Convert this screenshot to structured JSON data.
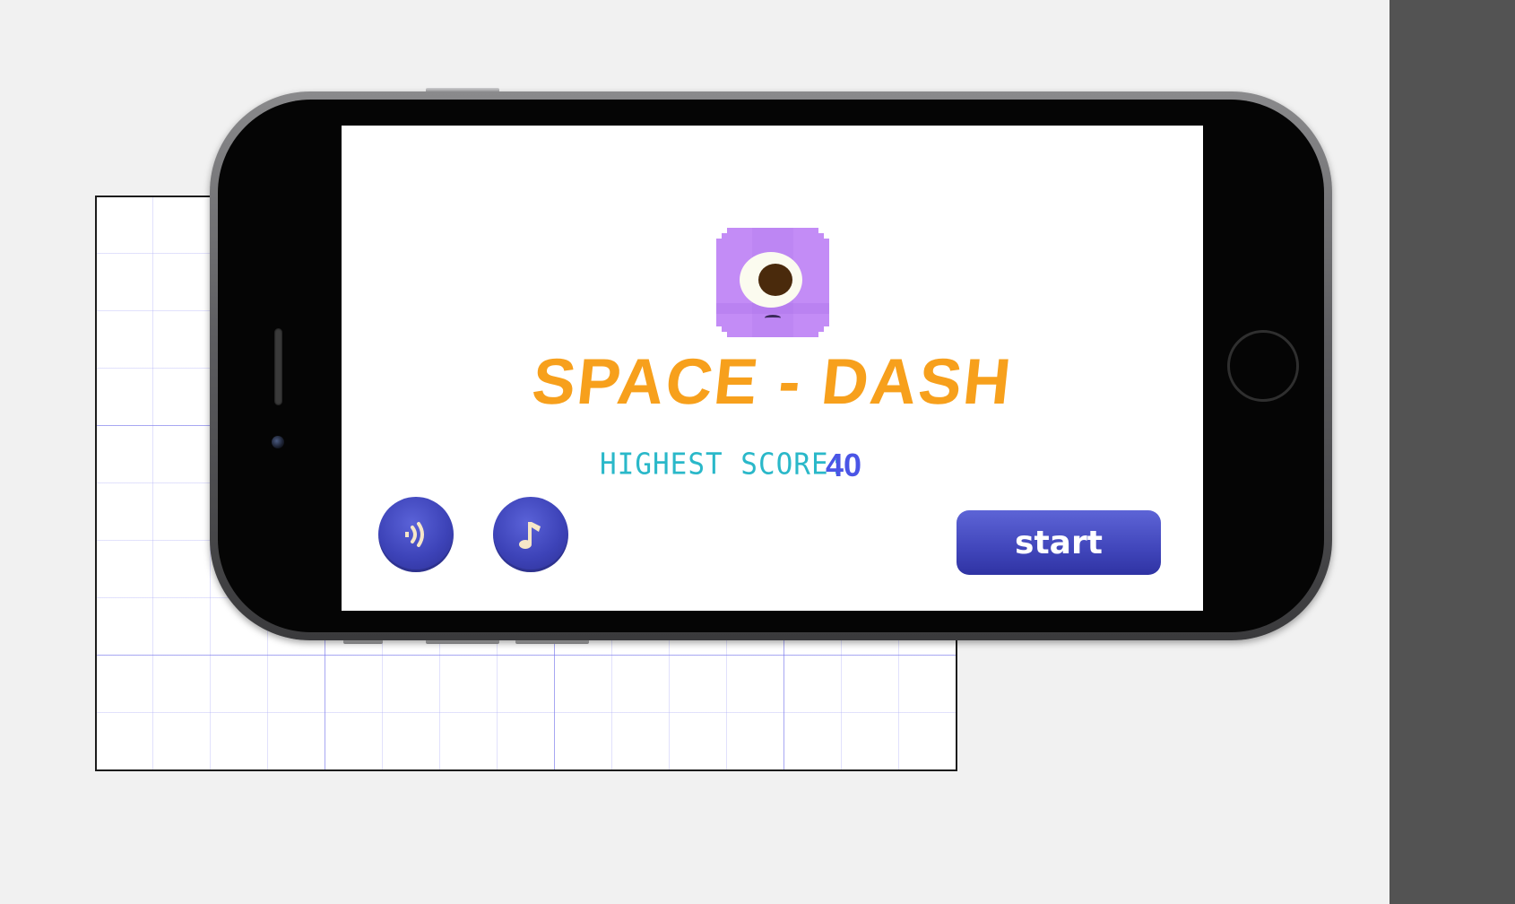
{
  "game": {
    "title": "SPACE - DASH",
    "highest_score_label": "HIGHEST SCORE:",
    "highest_score_value": "40",
    "start_label": "start"
  },
  "icons": {
    "sound": "sound-icon",
    "music": "music-note-icon",
    "character": "purple-one-eyed-monster"
  },
  "colors": {
    "title": "#f7a01c",
    "score_label": "#2ab8c9",
    "score_value": "#4a55e6",
    "button": "#4146bb",
    "monster": "#c38cf6"
  }
}
